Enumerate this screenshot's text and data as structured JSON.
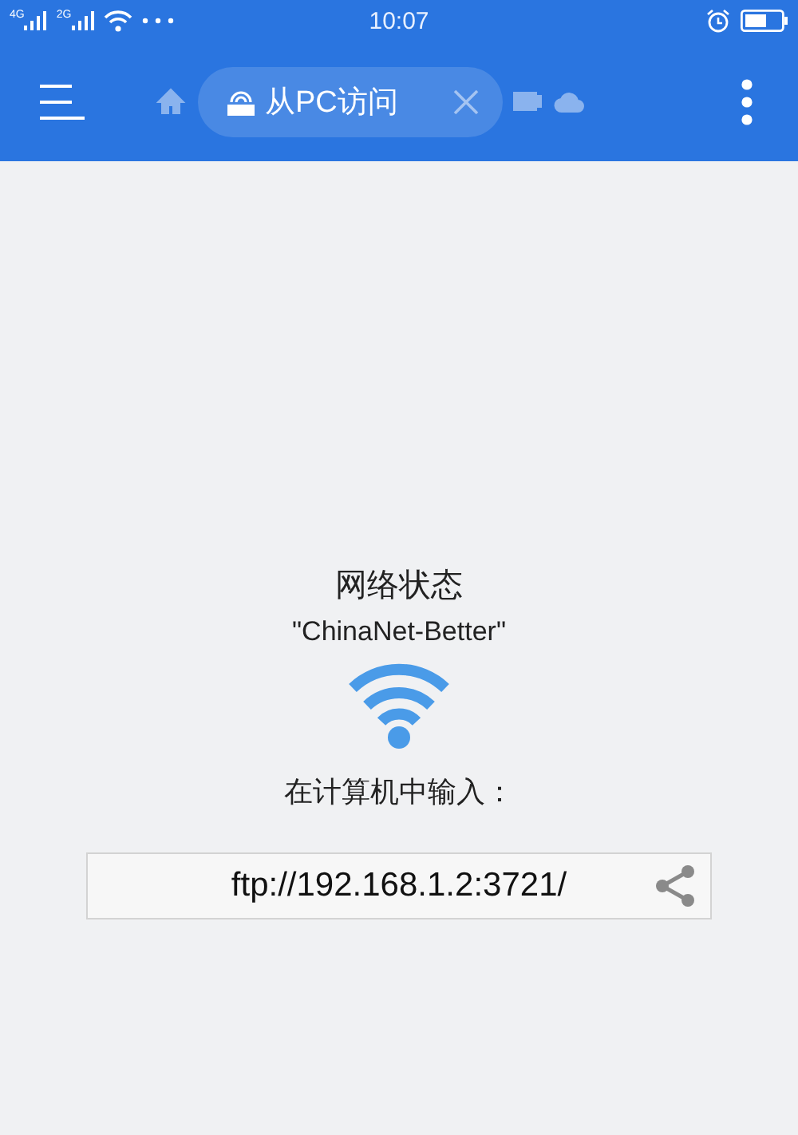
{
  "status_bar": {
    "signals": [
      {
        "label": "4G"
      },
      {
        "label": "2G"
      }
    ],
    "time": "10:07"
  },
  "tabs": [
    {
      "kind": "home",
      "selected": false
    },
    {
      "kind": "router",
      "label": "从PC访问",
      "selected": true
    },
    {
      "kind": "storage",
      "selected": false
    },
    {
      "kind": "cloud",
      "selected": false
    }
  ],
  "content": {
    "title": "网络状态",
    "network": "\"ChinaNet-Better\"",
    "prompt": "在计算机中输入：",
    "address": "ftp://192.168.1.2:3721/"
  }
}
